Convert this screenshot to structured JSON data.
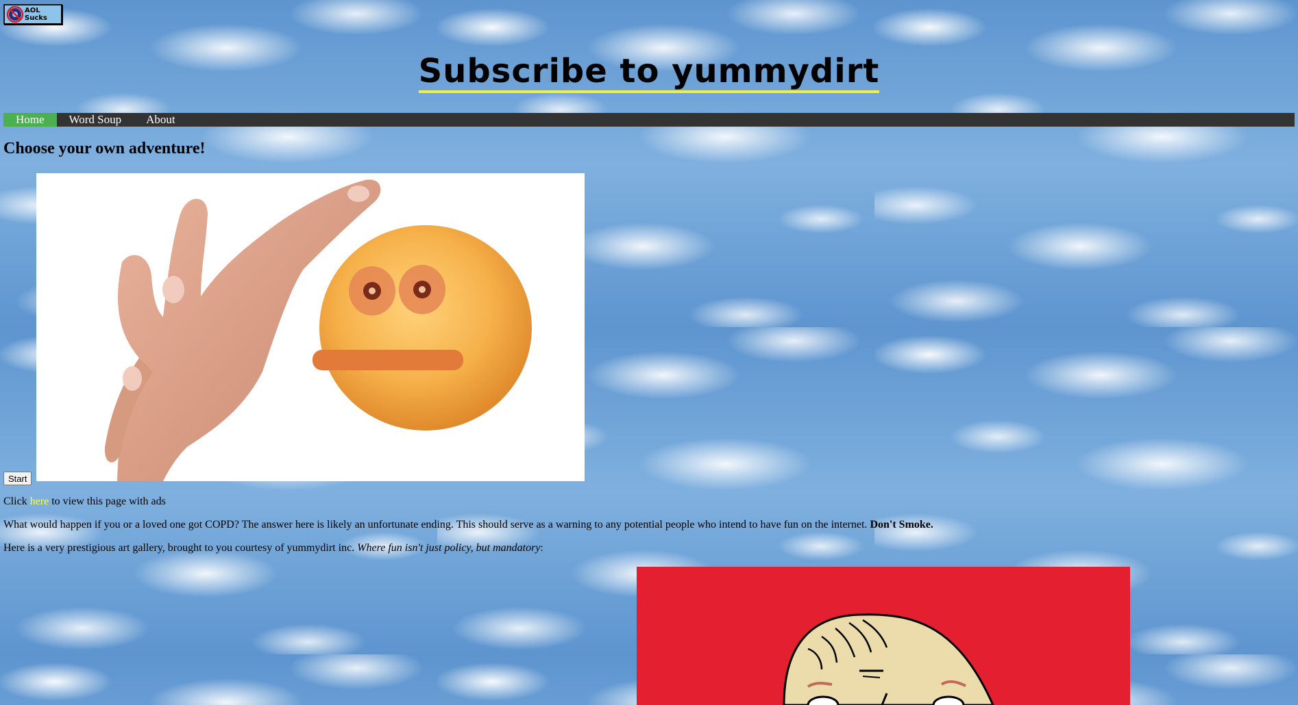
{
  "badge": {
    "label": "AOL Sucks",
    "icon": "no-aol-icon"
  },
  "header": {
    "title": "Subscribe to yummydirt",
    "underline_color": "#f2f23c"
  },
  "nav": {
    "items": [
      {
        "label": "Home",
        "active": true
      },
      {
        "label": "Word Soup",
        "active": false
      },
      {
        "label": "About",
        "active": false
      }
    ],
    "bar_color": "#333333",
    "active_color": "#4caf50"
  },
  "main": {
    "heading": "Choose your own adventure!",
    "adventure_image": "cursed-emoji-hand-image",
    "start_button": "Start",
    "ads_line": {
      "before": "Click ",
      "link": "here",
      "after": " to view this page with ads"
    },
    "copd_line": {
      "text": "What would happen if you or a loved one got COPD? The answer here is likely an unfortunate ending. This should serve as a warning to any potential people who intend to have fun on the internet. ",
      "bold": "Don't Smoke."
    },
    "gallery_line": {
      "text": "Here is a very prestigious art gallery, brought to you courtesy of yummydirt inc. ",
      "italic": "Where fun isn't just policy, but mandatory",
      "after": ":"
    },
    "gallery_image": "cartoon-head-drawing-image",
    "gallery_bg": "#e41f2f"
  }
}
